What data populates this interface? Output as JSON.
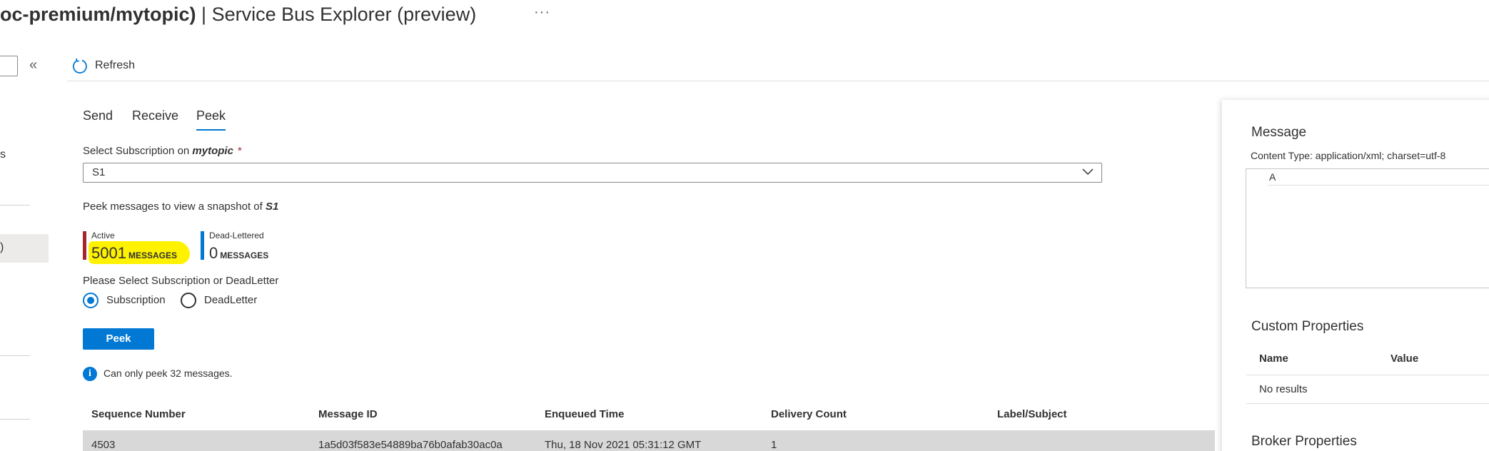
{
  "header": {
    "title_bold": "oc-premium/mytopic)",
    "title_rest": " | Service Bus Explorer (preview)",
    "more": "···"
  },
  "nav": {
    "collapse": "«",
    "fragment_1": "s",
    "fragment_2": ")"
  },
  "toolbar": {
    "refresh_label": "Refresh"
  },
  "tabs": [
    {
      "label": "Send",
      "active": false
    },
    {
      "label": "Receive",
      "active": false
    },
    {
      "label": "Peek",
      "active": true
    }
  ],
  "subscription": {
    "label_prefix": "Select Subscription on ",
    "topic": "mytopic",
    "required": "*",
    "selected": "S1"
  },
  "snapshot": {
    "text_prefix": "Peek messages to view a snapshot of ",
    "target": "S1"
  },
  "counters": {
    "active": {
      "title": "Active",
      "count": "5001",
      "unit": "MESSAGES",
      "color": "#a4262c"
    },
    "dead": {
      "title": "Dead-Lettered",
      "count": "0",
      "unit": "MESSAGES",
      "color": "#0078d4"
    }
  },
  "mode": {
    "label": "Please Select Subscription or DeadLetter",
    "options": [
      {
        "label": "Subscription",
        "selected": true
      },
      {
        "label": "DeadLetter",
        "selected": false
      }
    ]
  },
  "peek_button": "Peek",
  "info": {
    "icon": "i",
    "text": "Can only peek 32 messages."
  },
  "table": {
    "columns": [
      "Sequence Number",
      "Message ID",
      "Enqueued Time",
      "Delivery Count",
      "Label/Subject"
    ],
    "rows": [
      [
        "4503",
        "1a5d03f583e54889ba76b0afab30ac0a",
        "Thu, 18 Nov 2021 05:31:12 GMT",
        "1",
        ""
      ]
    ]
  },
  "panel": {
    "message_title": "Message",
    "content_type": "Content Type: application/xml; charset=utf-8",
    "body": "A",
    "custom_title": "Custom Properties",
    "custom_columns": [
      "Name",
      "Value"
    ],
    "custom_empty": "No results",
    "broker_title": "Broker Properties"
  },
  "colors": {
    "accent": "#0078d4",
    "highlight": "#fff200",
    "selected_row": "#d8d8d8"
  }
}
